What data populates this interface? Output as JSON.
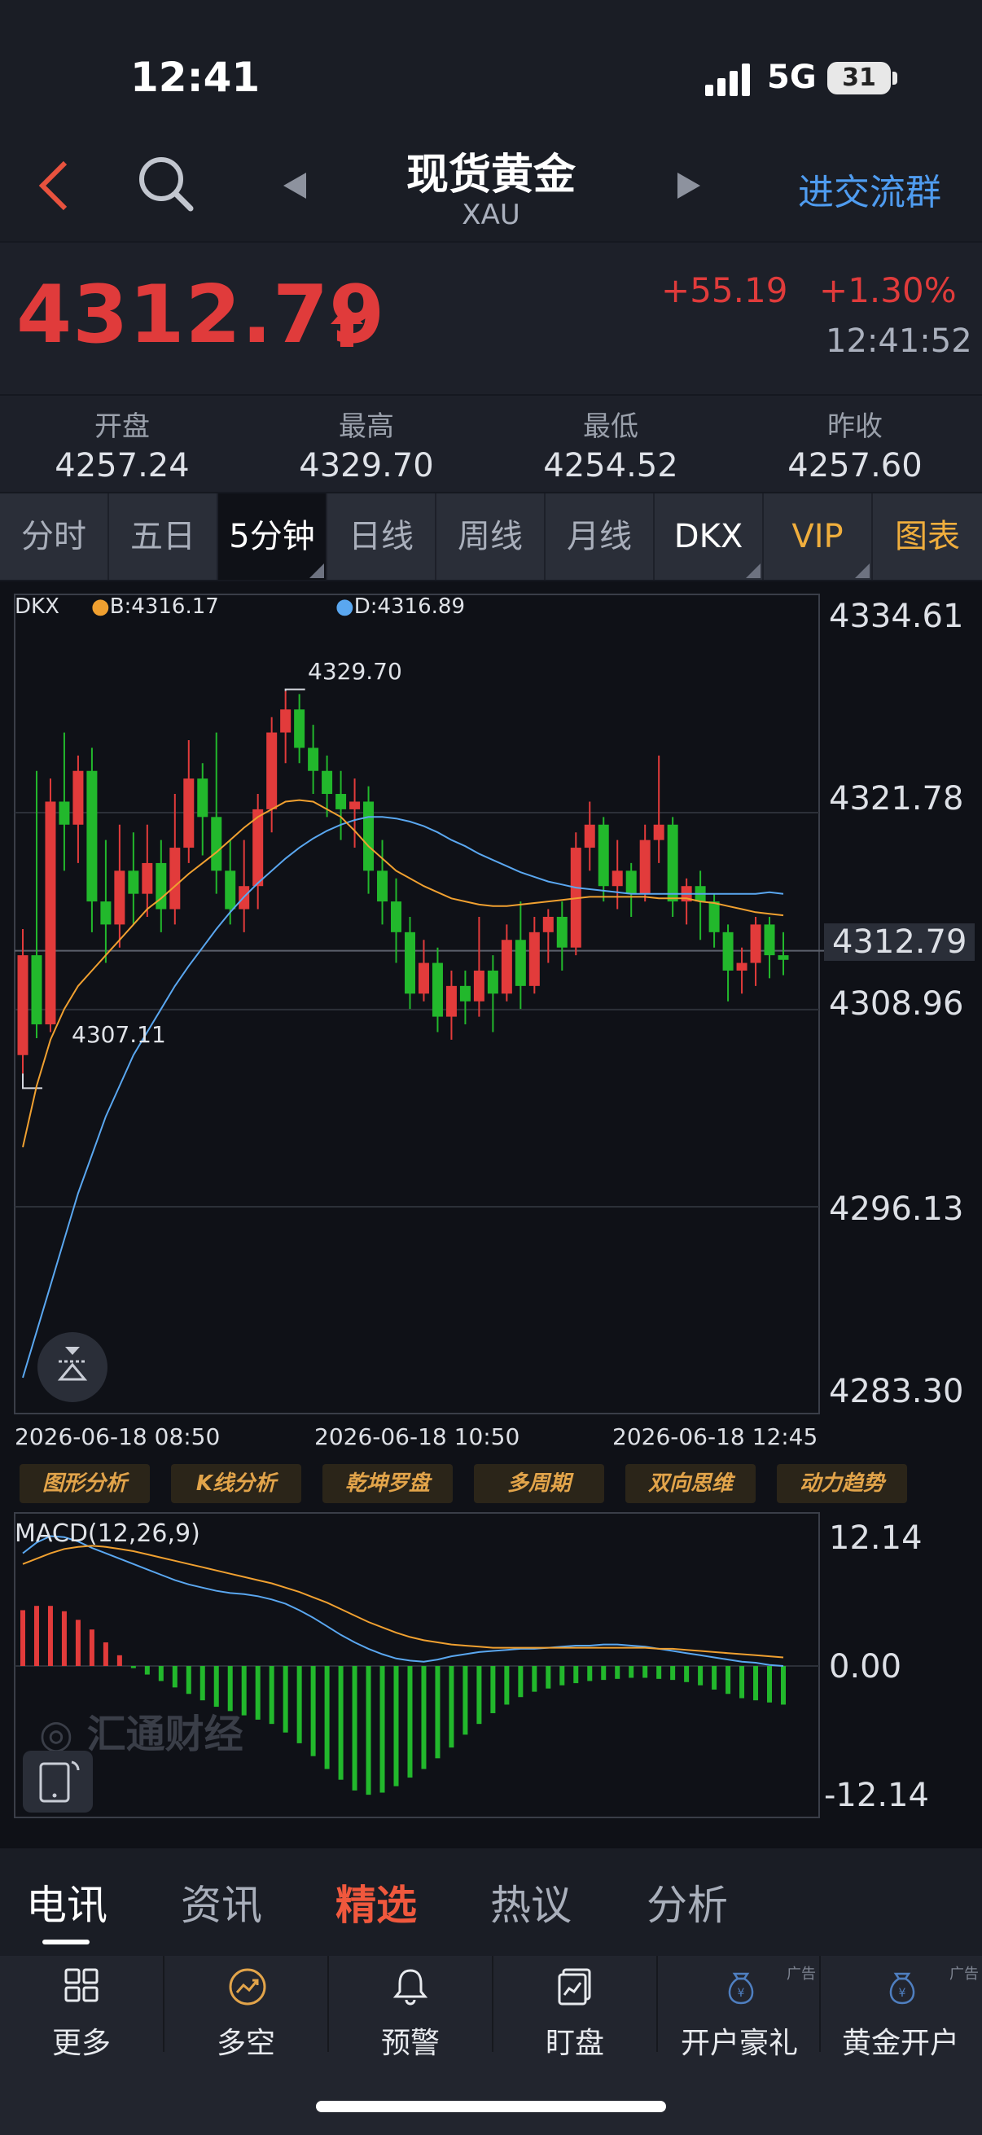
{
  "status": {
    "time": "12:41",
    "network": "5G",
    "battery": "31"
  },
  "header": {
    "title": "现货黄金",
    "code": "XAU",
    "join": "进交流群"
  },
  "quote": {
    "price": "4312.79",
    "change": "+55.19",
    "percent": "+1.30%",
    "time": "12:41:52",
    "up_color": "#e03b3b"
  },
  "stats": [
    {
      "label": "开盘",
      "value": "4257.24"
    },
    {
      "label": "最高",
      "value": "4329.70"
    },
    {
      "label": "最低",
      "value": "4254.52"
    },
    {
      "label": "昨收",
      "value": "4257.60"
    }
  ],
  "tabs": [
    "分时",
    "五日",
    "5分钟",
    "日线",
    "周线",
    "月线",
    "DKX",
    "VIP",
    "图表"
  ],
  "chart": {
    "legend_main": "DKX",
    "legend_b": "B:4316.17",
    "legend_d": "D:4316.89",
    "axis": [
      "4334.61",
      "4321.78",
      "4312.79",
      "4308.96",
      "4296.13",
      "4283.30"
    ],
    "high_mark": "4329.70",
    "low_mark": "4307.11",
    "xlabels": [
      "2026-06-18 08:50",
      "2026-06-18 10:50",
      "2026-06-18 12:45"
    ],
    "tools": [
      "图形分析",
      "K线分析",
      "乾坤罗盘",
      "多周期",
      "双向思维",
      "动力趋势"
    ],
    "macd_label": "MACD(12,26,9)",
    "macd_axis": [
      "12.14",
      "0.00",
      "-12.14"
    ],
    "watermark": "汇通财经",
    "up_color": "#e23b3b",
    "down_color": "#22b82c",
    "b_color": "#f0a030",
    "d_color": "#5aa7f0"
  },
  "chart_data": {
    "type": "candlestick",
    "ylim": [
      4283.3,
      4334.61
    ],
    "candles": [
      [
        4306.0,
        4312.5,
        4304.8,
        4314.2
      ],
      [
        4312.5,
        4308.0,
        4307.1,
        4324.5
      ],
      [
        4308.0,
        4322.5,
        4307.5,
        4324.0
      ],
      [
        4322.5,
        4321.0,
        4318.0,
        4327.0
      ],
      [
        4321.0,
        4324.5,
        4318.5,
        4325.5
      ],
      [
        4324.5,
        4316.0,
        4314.0,
        4326.0
      ],
      [
        4316.0,
        4314.5,
        4312.0,
        4320.0
      ],
      [
        4314.5,
        4318.0,
        4313.0,
        4321.0
      ],
      [
        4318.0,
        4316.5,
        4314.5,
        4320.5
      ],
      [
        4316.5,
        4318.5,
        4315.0,
        4321.0
      ],
      [
        4318.5,
        4315.5,
        4314.0,
        4320.0
      ],
      [
        4315.5,
        4319.5,
        4314.5,
        4323.0
      ],
      [
        4319.5,
        4324.0,
        4318.5,
        4326.5
      ],
      [
        4324.0,
        4321.5,
        4319.0,
        4325.0
      ],
      [
        4321.5,
        4318.0,
        4316.5,
        4327.0
      ],
      [
        4318.0,
        4315.5,
        4314.5,
        4320.0
      ],
      [
        4315.5,
        4317.0,
        4314.0,
        4320.0
      ],
      [
        4317.0,
        4322.0,
        4315.5,
        4323.0
      ],
      [
        4322.0,
        4327.0,
        4320.5,
        4328.0
      ],
      [
        4327.0,
        4328.5,
        4325.0,
        4329.7
      ],
      [
        4328.5,
        4326.0,
        4325.0,
        4329.5
      ],
      [
        4326.0,
        4324.5,
        4323.0,
        4327.5
      ],
      [
        4324.5,
        4323.0,
        4321.5,
        4325.5
      ],
      [
        4323.0,
        4322.0,
        4320.0,
        4324.5
      ],
      [
        4322.0,
        4322.5,
        4319.5,
        4324.0
      ],
      [
        4322.5,
        4318.0,
        4316.5,
        4323.5
      ],
      [
        4318.0,
        4316.0,
        4314.5,
        4320.0
      ],
      [
        4316.0,
        4314.0,
        4312.0,
        4317.5
      ],
      [
        4314.0,
        4310.0,
        4309.0,
        4315.0
      ],
      [
        4310.0,
        4312.0,
        4309.5,
        4313.5
      ],
      [
        4312.0,
        4308.5,
        4307.5,
        4313.0
      ],
      [
        4308.5,
        4310.5,
        4307.0,
        4311.5
      ],
      [
        4310.5,
        4309.5,
        4308.0,
        4311.5
      ],
      [
        4309.5,
        4311.5,
        4308.5,
        4315.0
      ],
      [
        4311.5,
        4310.0,
        4307.5,
        4312.5
      ],
      [
        4310.0,
        4313.5,
        4309.5,
        4314.5
      ],
      [
        4313.5,
        4310.5,
        4309.0,
        4316.0
      ],
      [
        4310.5,
        4314.0,
        4310.0,
        4315.0
      ],
      [
        4314.0,
        4315.0,
        4312.0,
        4315.5
      ],
      [
        4315.0,
        4313.0,
        4311.5,
        4316.0
      ],
      [
        4313.0,
        4319.5,
        4312.5,
        4320.5
      ],
      [
        4319.5,
        4321.0,
        4318.0,
        4322.5
      ],
      [
        4321.0,
        4317.0,
        4316.0,
        4321.5
      ],
      [
        4317.0,
        4318.0,
        4315.5,
        4320.0
      ],
      [
        4318.0,
        4316.5,
        4315.0,
        4318.5
      ],
      [
        4316.5,
        4320.0,
        4316.0,
        4321.0
      ],
      [
        4320.0,
        4321.0,
        4318.5,
        4325.5
      ],
      [
        4321.0,
        4316.0,
        4315.0,
        4321.5
      ],
      [
        4316.0,
        4317.0,
        4314.5,
        4317.5
      ],
      [
        4317.0,
        4316.0,
        4313.5,
        4318.0
      ],
      [
        4316.0,
        4314.0,
        4313.0,
        4316.5
      ],
      [
        4314.0,
        4311.5,
        4309.5,
        4314.5
      ],
      [
        4311.5,
        4312.0,
        4310.0,
        4313.0
      ],
      [
        4312.0,
        4314.5,
        4310.5,
        4315.0
      ],
      [
        4314.5,
        4312.5,
        4311.0,
        4315.0
      ],
      [
        4312.5,
        4312.2,
        4311.2,
        4314.0
      ]
    ],
    "b_line": [
      4300.0,
      4304.0,
      4307.0,
      4309.0,
      4310.5,
      4311.5,
      4312.5,
      4313.5,
      4314.5,
      4315.5,
      4316.2,
      4317.0,
      4317.8,
      4318.5,
      4319.2,
      4320.0,
      4320.8,
      4321.5,
      4322.0,
      4322.5,
      4322.6,
      4322.5,
      4322.0,
      4321.5,
      4320.6,
      4319.6,
      4318.8,
      4318.0,
      4317.5,
      4317.0,
      4316.6,
      4316.2,
      4316.0,
      4315.8,
      4315.7,
      4315.7,
      4315.8,
      4315.9,
      4316.0,
      4316.1,
      4316.2,
      4316.3,
      4316.3,
      4316.3,
      4316.3,
      4316.3,
      4316.2,
      4316.2,
      4316.2,
      4316.0,
      4315.9,
      4315.7,
      4315.5,
      4315.3,
      4315.2,
      4315.1
    ],
    "d_line": [
      4285.0,
      4288.0,
      4291.0,
      4294.0,
      4297.0,
      4299.5,
      4302.0,
      4304.0,
      4306.0,
      4307.5,
      4309.0,
      4310.5,
      4311.8,
      4313.0,
      4314.2,
      4315.3,
      4316.3,
      4317.2,
      4318.0,
      4318.8,
      4319.5,
      4320.1,
      4320.6,
      4321.0,
      4321.3,
      4321.5,
      4321.5,
      4321.4,
      4321.2,
      4320.9,
      4320.5,
      4320.0,
      4319.6,
      4319.1,
      4318.7,
      4318.3,
      4317.9,
      4317.6,
      4317.3,
      4317.1,
      4316.9,
      4316.8,
      4316.7,
      4316.6,
      4316.5,
      4316.5,
      4316.5,
      4316.5,
      4316.5,
      4316.5,
      4316.5,
      4316.5,
      4316.5,
      4316.5,
      4316.6,
      4316.5
    ],
    "macd_hist": [
      5.2,
      5.6,
      5.6,
      5.1,
      4.3,
      3.4,
      2.2,
      1.0,
      -0.2,
      -0.8,
      -1.4,
      -2.0,
      -2.6,
      -3.2,
      -3.8,
      -4.2,
      -4.6,
      -5.0,
      -5.4,
      -6.2,
      -7.2,
      -8.4,
      -9.6,
      -10.6,
      -11.6,
      -12.0,
      -11.8,
      -11.2,
      -10.4,
      -9.6,
      -8.6,
      -7.6,
      -6.4,
      -5.4,
      -4.4,
      -3.6,
      -2.9,
      -2.4,
      -2.1,
      -1.8,
      -1.6,
      -1.4,
      -1.3,
      -1.2,
      -1.1,
      -1.1,
      -1.2,
      -1.3,
      -1.5,
      -1.8,
      -2.2,
      -2.6,
      -3.0,
      -3.2,
      -3.4,
      -3.6
    ],
    "macd_dif": [
      10.5,
      11.5,
      12.1,
      12.0,
      11.6,
      11.0,
      10.5,
      10.0,
      9.5,
      9.0,
      8.5,
      8.0,
      7.6,
      7.3,
      7.0,
      6.8,
      6.7,
      6.5,
      6.2,
      5.8,
      5.2,
      4.5,
      3.7,
      2.9,
      2.2,
      1.6,
      1.1,
      0.7,
      0.5,
      0.4,
      0.6,
      0.9,
      1.1,
      1.3,
      1.4,
      1.5,
      1.6,
      1.6,
      1.7,
      1.8,
      1.9,
      1.9,
      2.0,
      2.0,
      1.9,
      1.8,
      1.6,
      1.4,
      1.2,
      1.0,
      0.8,
      0.6,
      0.4,
      0.3,
      0.1,
      0.0
    ],
    "macd_dea": [
      9.5,
      10.0,
      10.5,
      10.9,
      11.1,
      11.2,
      11.1,
      10.9,
      10.7,
      10.4,
      10.1,
      9.8,
      9.5,
      9.2,
      8.9,
      8.6,
      8.3,
      8.0,
      7.7,
      7.3,
      6.9,
      6.4,
      5.9,
      5.3,
      4.7,
      4.1,
      3.6,
      3.1,
      2.7,
      2.4,
      2.2,
      2.0,
      1.9,
      1.8,
      1.7,
      1.7,
      1.7,
      1.7,
      1.7,
      1.7,
      1.7,
      1.7,
      1.7,
      1.7,
      1.7,
      1.7,
      1.6,
      1.6,
      1.5,
      1.4,
      1.3,
      1.2,
      1.1,
      1.0,
      0.9,
      0.8
    ],
    "macd_ylim": [
      -12.14,
      12.14
    ]
  },
  "news_tabs": [
    "电讯",
    "资讯",
    "精选",
    "热议",
    "分析"
  ],
  "bottom": [
    {
      "label": "更多",
      "icon": "grid-icon"
    },
    {
      "label": "多空",
      "icon": "trend-icon"
    },
    {
      "label": "预警",
      "icon": "bell-icon"
    },
    {
      "label": "盯盘",
      "icon": "monitor-icon"
    },
    {
      "label": "开户豪礼",
      "icon": "coin-bag-icon",
      "ad": "广告"
    },
    {
      "label": "黄金开户",
      "icon": "coin-bag-icon",
      "ad": "广告"
    }
  ]
}
